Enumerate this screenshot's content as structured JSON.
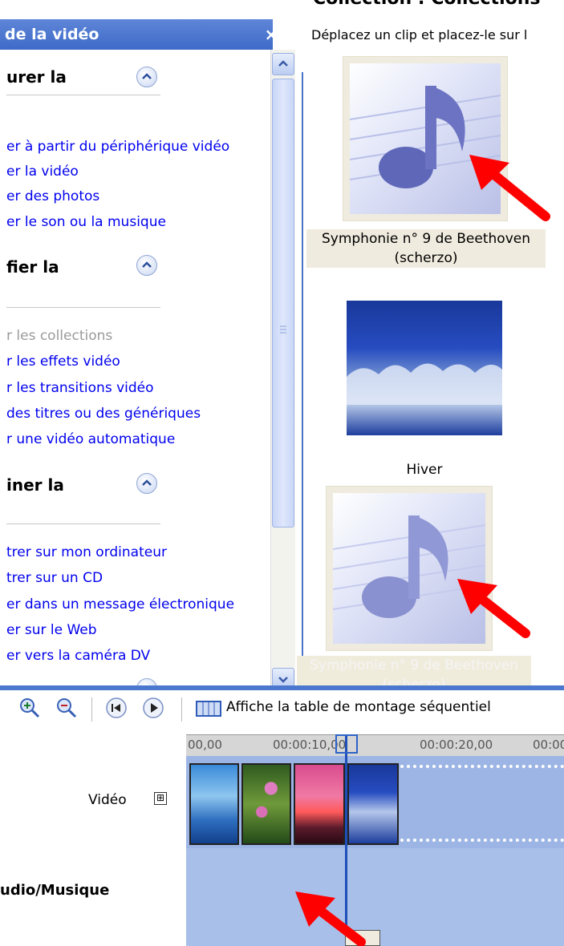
{
  "taskpane": {
    "title": "de la vidéo",
    "close": "×",
    "sections": [
      {
        "title": "urer la",
        "links": [
          {
            "label": "er à partir du périphérique vidéo",
            "enabled": true
          },
          {
            "label": "er la vidéo",
            "enabled": true
          },
          {
            "label": "er des photos",
            "enabled": true
          },
          {
            "label": "er le son ou la musique",
            "enabled": true
          }
        ]
      },
      {
        "title": "fier la",
        "links": [
          {
            "label": "r les collections",
            "enabled": false
          },
          {
            "label": "r les effets vidéo",
            "enabled": true
          },
          {
            "label": "r les transitions vidéo",
            "enabled": true
          },
          {
            "label": "des titres ou des génériques",
            "enabled": true
          },
          {
            "label": "r une vidéo automatique",
            "enabled": true
          }
        ]
      },
      {
        "title": "iner la",
        "links": [
          {
            "label": "trer sur mon ordinateur",
            "enabled": true
          },
          {
            "label": "trer sur un CD",
            "enabled": true
          },
          {
            "label": "er dans un message électronique",
            "enabled": true
          },
          {
            "label": "er sur le Web",
            "enabled": true
          },
          {
            "label": "er vers la caméra DV",
            "enabled": true
          }
        ]
      }
    ]
  },
  "collection": {
    "title": "Collection : Collections",
    "hint": "Déplacez un clip et placez-le sur l",
    "items": [
      {
        "caption_line1": "Symphonie n° 9 de Beethoven",
        "caption_line2": "(scherzo)",
        "kind": "music-note-icon"
      },
      {
        "caption_line1": "Hiver",
        "caption_line2": "",
        "kind": "winter-image"
      },
      {
        "caption_line1": "Symphonie n° 9 de Beethoven",
        "caption_line2": "(scherzo)",
        "kind": "music-note-icon"
      }
    ]
  },
  "timeline": {
    "storyboard_label": "Affiche la table de montage séquentiel",
    "ticks": [
      "00,00",
      "00:00:10,00",
      "00:00:20,00",
      "00:00"
    ],
    "tracks": {
      "video": "Vidéo",
      "video_expand": "⊞",
      "audio": "udio/Musique"
    },
    "clips": [
      "blue-hills-clip",
      "water-lilies-clip",
      "sunset-clip",
      "winter-clip"
    ]
  },
  "colors": {
    "accent": "#3f6ac8",
    "link": "#0000ee",
    "arrow": "#ff0000",
    "track": "#9db5e5"
  }
}
